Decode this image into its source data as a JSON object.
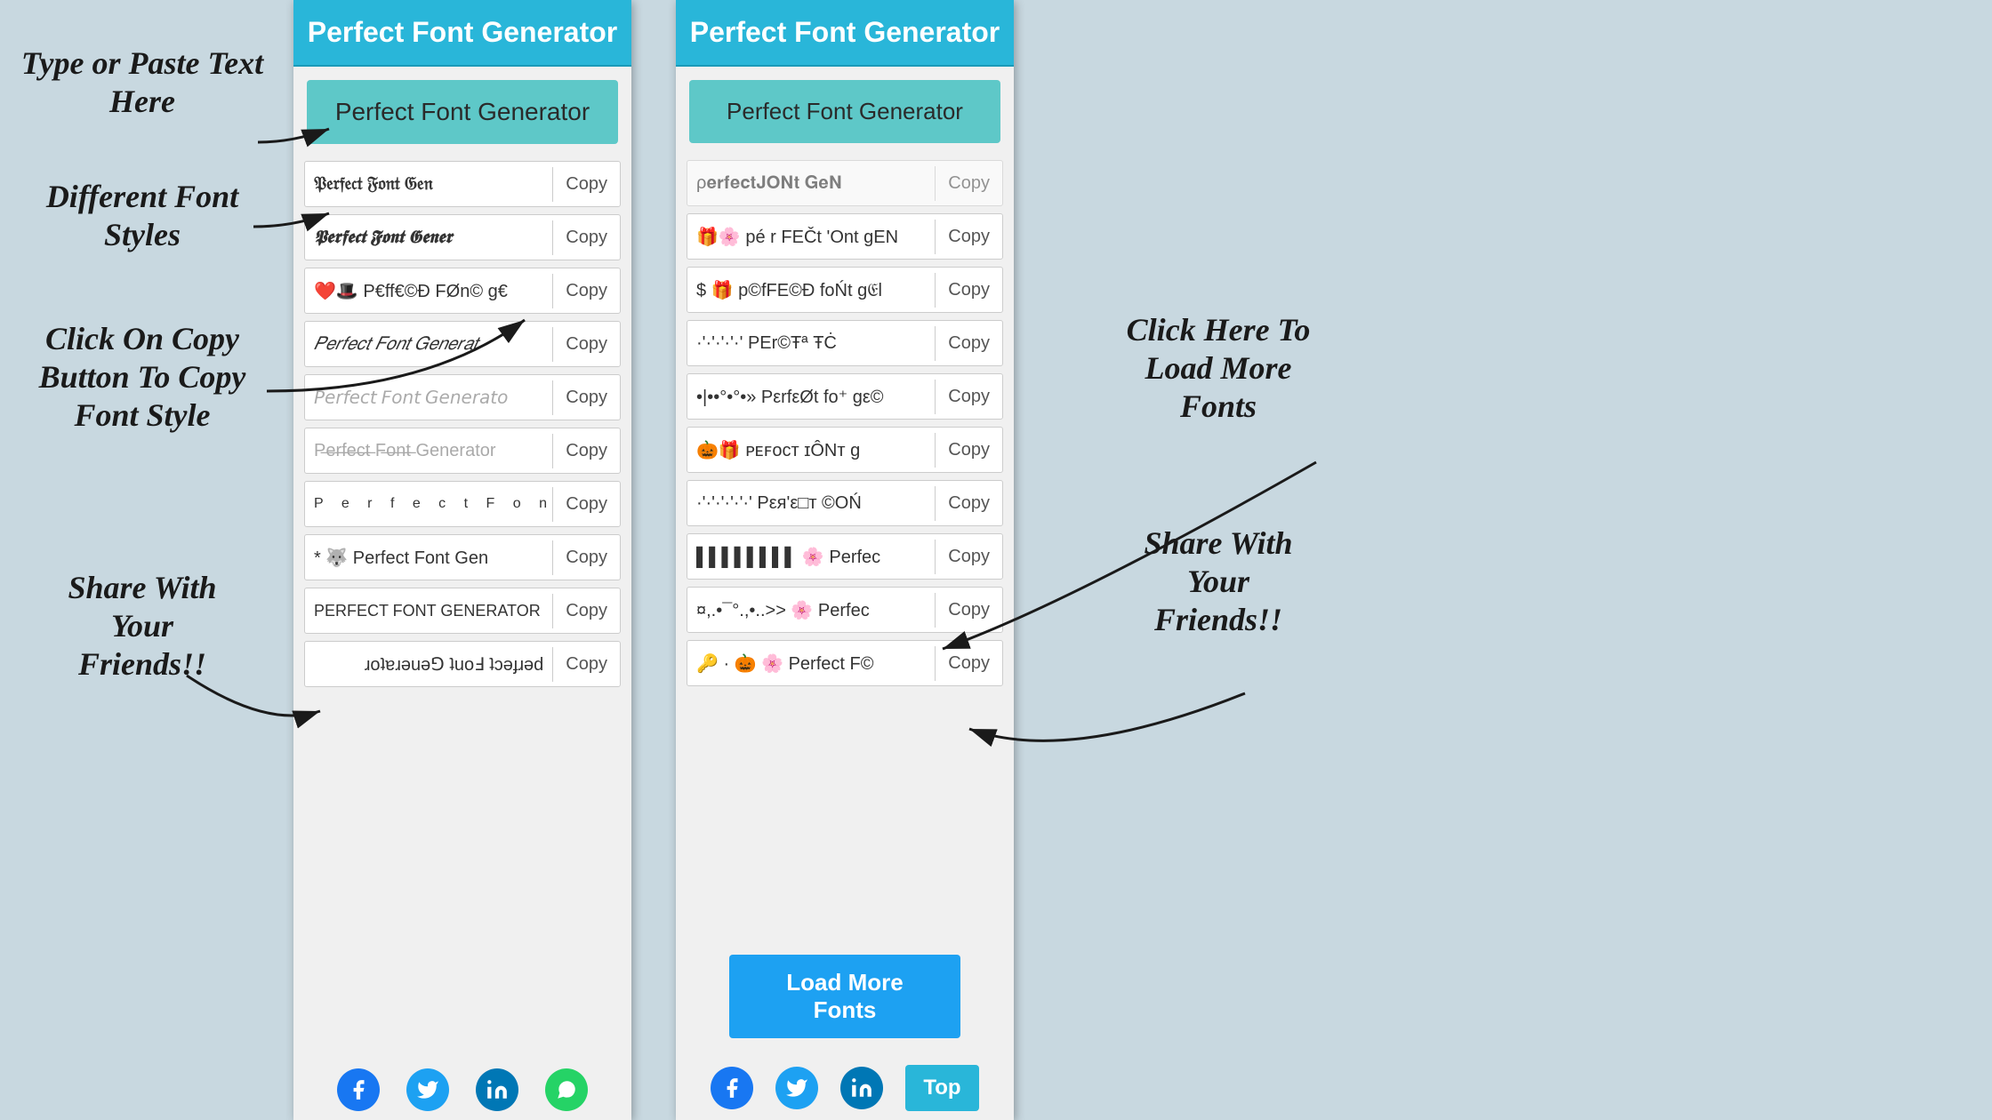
{
  "page": {
    "bg_color": "#c8d8e0"
  },
  "annotations": {
    "type_paste": "Type or Paste Text\nHere",
    "different_fonts": "Different Font\nStyles",
    "click_copy": "Click On Copy\nButton To Copy\nFont Style",
    "share": "Share With\nYour\nFriends!!",
    "click_load": "Click Here To\nLoad More\nFonts",
    "share2": "Share With\nYour\nFriends!!"
  },
  "panel_left": {
    "header": "Perfect Font Generator",
    "input_value": "Perfect Font Generator",
    "font_rows": [
      {
        "text": "𝔓𝔢𝔯𝔣𝔢𝔠𝔱 𝔉𝔬𝔫𝔱 𝔊𝔢𝔫𝔢𝔯𝔞𝔱𝔬𝔯",
        "copy": "Copy",
        "style": "blackletter"
      },
      {
        "text": "𝕻𝖊𝖗𝖋𝖊𝖈𝖙 𝕱𝖔𝖓𝖙 𝕲𝖊𝖓𝖊𝖗𝖆𝖙𝖔𝖗",
        "copy": "Copy",
        "style": "bold-blackletter"
      },
      {
        "text": "❤️🎩 P€ff€©Ð FØn© g€",
        "copy": "Copy",
        "style": "emoji"
      },
      {
        "text": "𝑃𝑒𝑟𝑓𝑒𝑐𝑡 𝐹𝑜𝑛𝑡 𝐺𝑒𝑛𝑒𝑟𝑎𝑡",
        "copy": "Copy",
        "style": "italic"
      },
      {
        "text": "𝘗𝘦𝘳𝘧𝘦𝘤𝘵 𝘍𝘰𝘯𝘵 𝘎𝘦𝘯𝘦𝘳𝘢𝘵𝘰",
        "copy": "Copy",
        "style": "italic2"
      },
      {
        "text": "P̶e̶r̶f̶e̶c̶t̶ F̶o̶n̶t̶ Generator",
        "copy": "Copy",
        "style": "strikethrough"
      },
      {
        "text": "P  e  r  f  e  c  t    F  o  n  t",
        "copy": "Copy",
        "style": "spaced"
      },
      {
        "text": "* 🐺 Perfect Font Gen",
        "copy": "Copy",
        "style": "emoji2"
      },
      {
        "text": "PERFECT FONT GENERATOR",
        "copy": "Copy",
        "style": "uppercase"
      },
      {
        "text": "ɹoʇɐɹǝuǝ⅁ ʇuoℲ ʇɔǝɟɹǝd",
        "copy": "Copy",
        "style": "reversed"
      }
    ],
    "share_icons": [
      "facebook",
      "twitter",
      "linkedin",
      "whatsapp"
    ]
  },
  "panel_right": {
    "header": "Perfect Font Generator",
    "input_value": "Perfect Font Generator",
    "font_rows": [
      {
        "text": "ρ𝐞𝐫𝐟𝐞𝐜𝐭𝐉𝐎𝐍𝐭 𝐆𝐞𝐍",
        "copy": "Copy",
        "style": "bold"
      },
      {
        "text": "🎁🌸 pé r FEČt 'Ont gEN",
        "copy": "Copy",
        "style": "deco1"
      },
      {
        "text": "$ 🎁 p©fFE©Ð foŃt ɡ𝔈l",
        "copy": "Copy",
        "style": "deco2"
      },
      {
        "text": "·'·'·'·'·' ΡΕr©Ŧª ŦĊ",
        "copy": "Copy",
        "style": "dots"
      },
      {
        "text": "•|••°•°•» PεrfεØt fo⁺ gε©",
        "copy": "Copy",
        "style": "bullets"
      },
      {
        "text": "🎃🎁 ᴘᴇꜰᴏᴄᴛ ɪÔNт g",
        "copy": "Copy",
        "style": "small-caps"
      },
      {
        "text": "·'·'·'·'·'·' Pεя'ε□т ©ОŃ",
        "copy": "Copy",
        "style": "dots2"
      },
      {
        "text": "▌▌▌▌▌▌▌▌ 🌸 Perfec",
        "copy": "Copy",
        "style": "bars"
      },
      {
        "text": "¤,.•¯°.,•..>> 🌸 Perfec",
        "copy": "Copy",
        "style": "fancy"
      },
      {
        "text": "🔑 · 🎃 🌸 Perfect F©",
        "copy": "Copy",
        "style": "emoji3"
      }
    ],
    "load_more": "Load More Fonts",
    "top_btn": "Top",
    "share_icons": [
      "facebook",
      "twitter",
      "linkedin"
    ]
  },
  "copy_label": "Copy"
}
